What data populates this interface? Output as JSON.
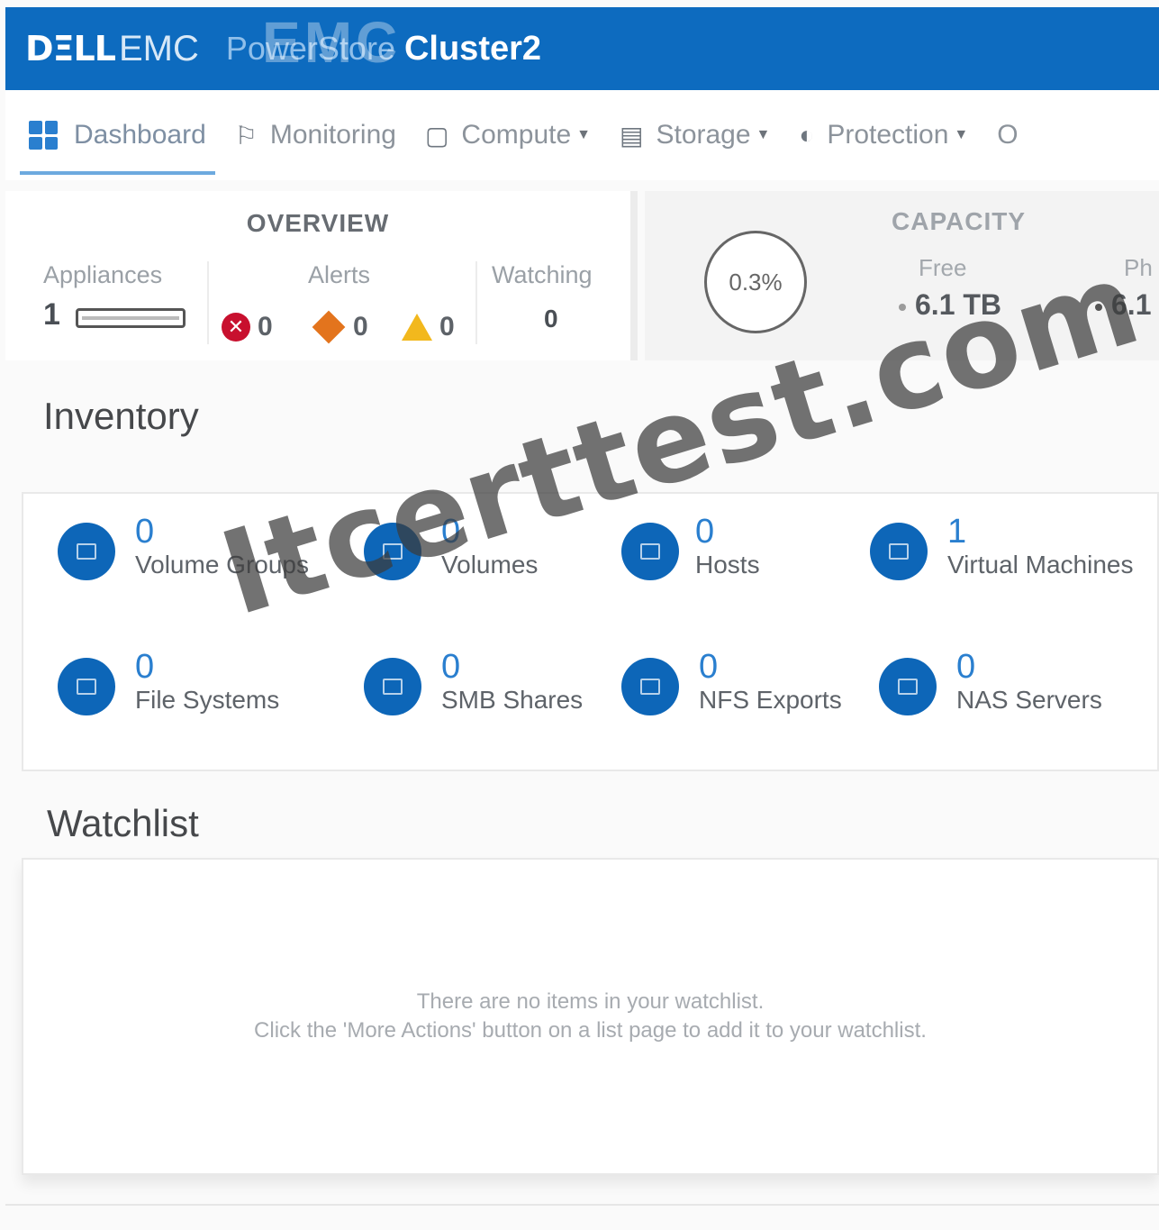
{
  "header": {
    "brand_dell": "DΞLL",
    "brand_emc": "EMC",
    "product": "PowerStore",
    "cluster": "Cluster2",
    "overlay": "EMC"
  },
  "nav": {
    "dashboard": "Dashboard",
    "monitoring": "Monitoring",
    "compute": "Compute",
    "storage": "Storage",
    "protection": "Protection",
    "more_partial": "O"
  },
  "overview": {
    "title": "OVERVIEW",
    "appliances_label": "Appliances",
    "appliances_value": "1",
    "alerts_label": "Alerts",
    "alerts_critical": "0",
    "alerts_major": "0",
    "alerts_minor": "0",
    "watching_label": "Watching",
    "watching_value": "0"
  },
  "capacity": {
    "title": "CAPACITY",
    "used_percent": "0.3%",
    "free_label": "Free",
    "free_value": "6.1 TB",
    "physical_label_partial": "Ph",
    "physical_value_partial": "6.1"
  },
  "inventory": {
    "title": "Inventory",
    "items": [
      {
        "count": "0",
        "label": "Volume Groups",
        "icon": "volume-groups-icon"
      },
      {
        "count": "0",
        "label": "Volumes",
        "icon": "volumes-icon"
      },
      {
        "count": "0",
        "label": "Hosts",
        "icon": "hosts-icon"
      },
      {
        "count": "1",
        "label": "Virtual Machines",
        "icon": "virtual-machines-icon"
      },
      {
        "count": "0",
        "label": "File Systems",
        "icon": "file-systems-icon"
      },
      {
        "count": "0",
        "label": "SMB Shares",
        "icon": "smb-shares-icon"
      },
      {
        "count": "0",
        "label": "NFS Exports",
        "icon": "nfs-exports-icon"
      },
      {
        "count": "0",
        "label": "NAS Servers",
        "icon": "nas-servers-icon"
      }
    ]
  },
  "watchlist": {
    "title": "Watchlist",
    "empty_line1": "There are no items in your watchlist.",
    "empty_line2": "Click the 'More Actions' button on a list page to add it to your watchlist."
  },
  "watermark": "Itcerttest.com",
  "colors": {
    "header": "#0d6bbf",
    "accent": "#2a7fcf",
    "critical": "#c8102e",
    "major": "#e3741d",
    "minor": "#f2b81d"
  }
}
